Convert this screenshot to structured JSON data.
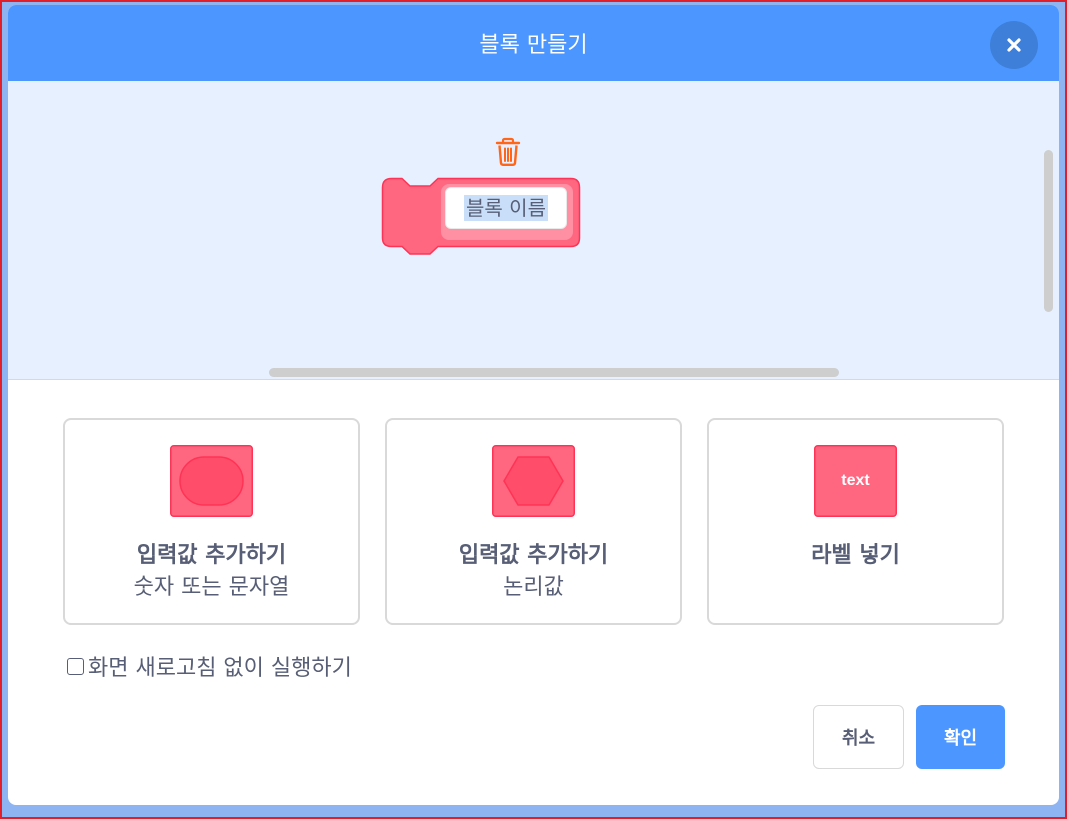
{
  "dialog": {
    "title": "블록 만들기"
  },
  "workspace": {
    "block_name_placeholder": "블록 이름"
  },
  "options": [
    {
      "icon": "round-input-icon",
      "title": "입력값 추가하기",
      "subtitle": "숫자 또는 문자열"
    },
    {
      "icon": "boolean-input-icon",
      "title": "입력값 추가하기",
      "subtitle": "논리값"
    },
    {
      "icon": "label-icon",
      "icon_text": "text",
      "title": "라벨 넣기",
      "subtitle": ""
    }
  ],
  "run_without_refresh": {
    "label": "화면 새로고침 없이 실행하기",
    "checked": false
  },
  "buttons": {
    "cancel": "취소",
    "ok": "확인"
  },
  "colors": {
    "header": "#4c97ff",
    "block_fill": "#ff6680",
    "block_stroke": "#ff3355",
    "workspace_bg": "#e6f0ff",
    "trash": "#ff661a"
  }
}
